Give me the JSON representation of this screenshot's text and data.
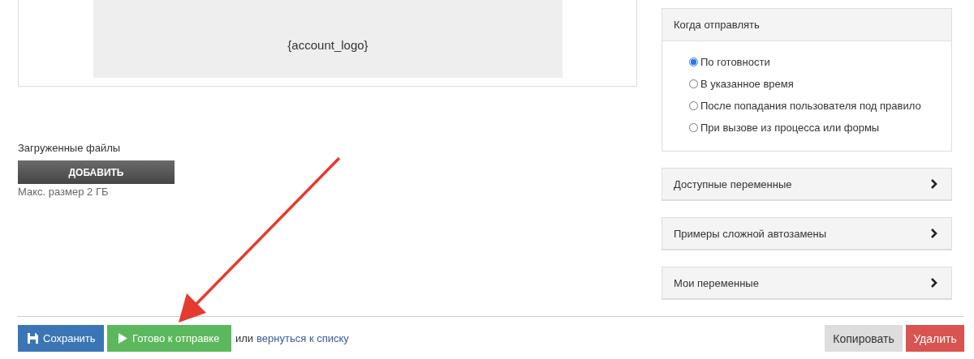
{
  "logo_preview": {
    "text": "{account_logo}"
  },
  "uploads": {
    "title": "Загруженные файлы",
    "add_button": "ДОБАВИТЬ",
    "hint": "Макс. размер 2 ГБ"
  },
  "send_when": {
    "title": "Когда отправлять",
    "options": [
      {
        "label": "По готовности",
        "selected": true
      },
      {
        "label": "В указанное время",
        "selected": false
      },
      {
        "label": "После попадания пользователя под правило",
        "selected": false
      },
      {
        "label": "При вызове из процесса или формы",
        "selected": false
      }
    ]
  },
  "sections": [
    {
      "title": "Доступные переменные",
      "expanded": false
    },
    {
      "title": "Примеры сложной автозамены",
      "expanded": false
    },
    {
      "title": "Мои переменные",
      "expanded": false
    }
  ],
  "footer": {
    "save": "Сохранить",
    "ready": "Готово к отправке",
    "or_text": "или",
    "back_link": "вернуться к списку",
    "copy": "Копировать",
    "delete": "Удалить"
  }
}
